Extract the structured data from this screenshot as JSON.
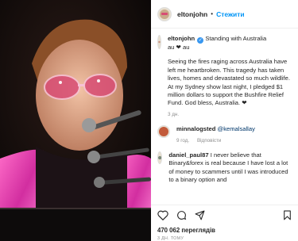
{
  "header": {
    "username": "eltonjohn",
    "follow_label": "Стежити"
  },
  "caption": {
    "username": "eltonjohn",
    "line1": "Standing with Australia",
    "line2": "au ❤ au",
    "text": "Seeing the fires raging across Australia have left me heartbroken. This tragedy has taken lives, homes and devastated so much wildlife. At my Sydney show last night, I pledged $1 million dollars to support the Bushfire Relief Fund. God bless, Australia. ❤",
    "time": "3 дн."
  },
  "comments": [
    {
      "username": "minnalogsted",
      "mention": "@kemalsallay",
      "time": "9 год.",
      "reply_label": "Відповісти"
    },
    {
      "username": "daniel_paul87",
      "text": "I never believe that Binary&forex is real because I have lost a lot of money to scammers until I was introduced to a binary option and"
    }
  ],
  "stats": {
    "views": "470 062 переглядів",
    "posted": "3 ДН. ТОМУ"
  },
  "icons": [
    "heart-icon",
    "comment-icon",
    "share-icon",
    "bookmark-icon"
  ],
  "colors": {
    "follow": "#0095f6",
    "heart": "#ed4956",
    "verified": "#3897f0"
  }
}
